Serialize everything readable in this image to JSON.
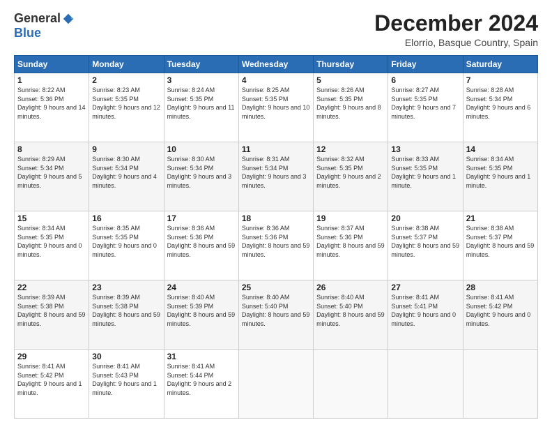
{
  "logo": {
    "general": "General",
    "blue": "Blue"
  },
  "header": {
    "month": "December 2024",
    "location": "Elorrio, Basque Country, Spain"
  },
  "weekdays": [
    "Sunday",
    "Monday",
    "Tuesday",
    "Wednesday",
    "Thursday",
    "Friday",
    "Saturday"
  ],
  "weeks": [
    [
      {
        "day": "1",
        "sunrise": "8:22 AM",
        "sunset": "5:36 PM",
        "daylight": "9 hours and 14 minutes."
      },
      {
        "day": "2",
        "sunrise": "8:23 AM",
        "sunset": "5:35 PM",
        "daylight": "9 hours and 12 minutes."
      },
      {
        "day": "3",
        "sunrise": "8:24 AM",
        "sunset": "5:35 PM",
        "daylight": "9 hours and 11 minutes."
      },
      {
        "day": "4",
        "sunrise": "8:25 AM",
        "sunset": "5:35 PM",
        "daylight": "9 hours and 10 minutes."
      },
      {
        "day": "5",
        "sunrise": "8:26 AM",
        "sunset": "5:35 PM",
        "daylight": "9 hours and 8 minutes."
      },
      {
        "day": "6",
        "sunrise": "8:27 AM",
        "sunset": "5:35 PM",
        "daylight": "9 hours and 7 minutes."
      },
      {
        "day": "7",
        "sunrise": "8:28 AM",
        "sunset": "5:34 PM",
        "daylight": "9 hours and 6 minutes."
      }
    ],
    [
      {
        "day": "8",
        "sunrise": "8:29 AM",
        "sunset": "5:34 PM",
        "daylight": "9 hours and 5 minutes."
      },
      {
        "day": "9",
        "sunrise": "8:30 AM",
        "sunset": "5:34 PM",
        "daylight": "9 hours and 4 minutes."
      },
      {
        "day": "10",
        "sunrise": "8:30 AM",
        "sunset": "5:34 PM",
        "daylight": "9 hours and 3 minutes."
      },
      {
        "day": "11",
        "sunrise": "8:31 AM",
        "sunset": "5:34 PM",
        "daylight": "9 hours and 3 minutes."
      },
      {
        "day": "12",
        "sunrise": "8:32 AM",
        "sunset": "5:35 PM",
        "daylight": "9 hours and 2 minutes."
      },
      {
        "day": "13",
        "sunrise": "8:33 AM",
        "sunset": "5:35 PM",
        "daylight": "9 hours and 1 minute."
      },
      {
        "day": "14",
        "sunrise": "8:34 AM",
        "sunset": "5:35 PM",
        "daylight": "9 hours and 1 minute."
      }
    ],
    [
      {
        "day": "15",
        "sunrise": "8:34 AM",
        "sunset": "5:35 PM",
        "daylight": "9 hours and 0 minutes."
      },
      {
        "day": "16",
        "sunrise": "8:35 AM",
        "sunset": "5:35 PM",
        "daylight": "9 hours and 0 minutes."
      },
      {
        "day": "17",
        "sunrise": "8:36 AM",
        "sunset": "5:36 PM",
        "daylight": "8 hours and 59 minutes."
      },
      {
        "day": "18",
        "sunrise": "8:36 AM",
        "sunset": "5:36 PM",
        "daylight": "8 hours and 59 minutes."
      },
      {
        "day": "19",
        "sunrise": "8:37 AM",
        "sunset": "5:36 PM",
        "daylight": "8 hours and 59 minutes."
      },
      {
        "day": "20",
        "sunrise": "8:38 AM",
        "sunset": "5:37 PM",
        "daylight": "8 hours and 59 minutes."
      },
      {
        "day": "21",
        "sunrise": "8:38 AM",
        "sunset": "5:37 PM",
        "daylight": "8 hours and 59 minutes."
      }
    ],
    [
      {
        "day": "22",
        "sunrise": "8:39 AM",
        "sunset": "5:38 PM",
        "daylight": "8 hours and 59 minutes."
      },
      {
        "day": "23",
        "sunrise": "8:39 AM",
        "sunset": "5:38 PM",
        "daylight": "8 hours and 59 minutes."
      },
      {
        "day": "24",
        "sunrise": "8:40 AM",
        "sunset": "5:39 PM",
        "daylight": "8 hours and 59 minutes."
      },
      {
        "day": "25",
        "sunrise": "8:40 AM",
        "sunset": "5:40 PM",
        "daylight": "8 hours and 59 minutes."
      },
      {
        "day": "26",
        "sunrise": "8:40 AM",
        "sunset": "5:40 PM",
        "daylight": "8 hours and 59 minutes."
      },
      {
        "day": "27",
        "sunrise": "8:41 AM",
        "sunset": "5:41 PM",
        "daylight": "9 hours and 0 minutes."
      },
      {
        "day": "28",
        "sunrise": "8:41 AM",
        "sunset": "5:42 PM",
        "daylight": "9 hours and 0 minutes."
      }
    ],
    [
      {
        "day": "29",
        "sunrise": "8:41 AM",
        "sunset": "5:42 PM",
        "daylight": "9 hours and 1 minute."
      },
      {
        "day": "30",
        "sunrise": "8:41 AM",
        "sunset": "5:43 PM",
        "daylight": "9 hours and 1 minute."
      },
      {
        "day": "31",
        "sunrise": "8:41 AM",
        "sunset": "5:44 PM",
        "daylight": "9 hours and 2 minutes."
      },
      null,
      null,
      null,
      null
    ]
  ]
}
